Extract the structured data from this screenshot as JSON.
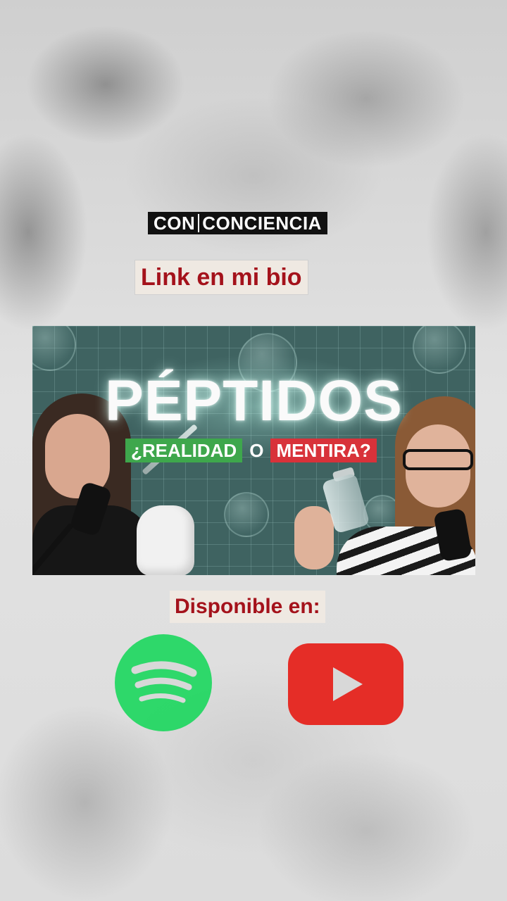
{
  "brand": {
    "word1": "CON",
    "word2": "CONCIENCIA"
  },
  "link_label": "Link en mi bio",
  "thumbnail": {
    "title": "PÉPTIDOS",
    "subtitle_left": "¿REALIDAD",
    "subtitle_middle": "O",
    "subtitle_right": "MENTIRA?"
  },
  "available_label": "Disponible en:",
  "platforms": [
    {
      "name": "spotify-icon",
      "color": "#1ed760"
    },
    {
      "name": "youtube-icon",
      "color": "#e52d27"
    }
  ],
  "colors": {
    "label_text": "#a4121b",
    "label_bg": "#efe9e2",
    "tag_green": "#3ea74c",
    "tag_red": "#d8323a",
    "thumb_bg": "#3f6361"
  }
}
